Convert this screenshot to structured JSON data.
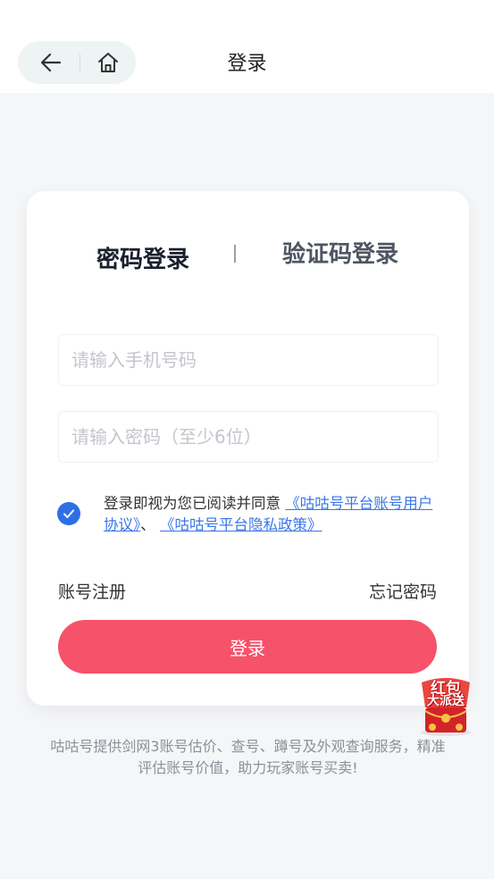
{
  "header": {
    "title": "登录"
  },
  "tabs": {
    "password_login": "密码登录",
    "code_login": "验证码登录"
  },
  "form": {
    "phone_placeholder": "请输入手机号码",
    "password_placeholder": "请输入密码（至少6位）"
  },
  "agreement": {
    "checked": true,
    "prefix": "登录即视为您已阅读并同意 ",
    "user_agreement": "《咕咕号平台账号用户协议》",
    "separator": "、",
    "privacy_policy": "《咕咕号平台隐私政策》"
  },
  "links": {
    "register": "账号注册",
    "forgot": "忘记密码"
  },
  "login_button": "登录",
  "footer": {
    "line1": "咕咕号提供剑网3账号估价、查号、蹲号及外观查询服务，精准",
    "line2": "评估账号价值，助力玩家账号买卖!"
  },
  "promo": {
    "line1": "红包",
    "line2": "大派送"
  },
  "colors": {
    "accent_red": "#f6526a",
    "link_blue": "#3a76e8",
    "check_blue": "#2f6fe6"
  }
}
